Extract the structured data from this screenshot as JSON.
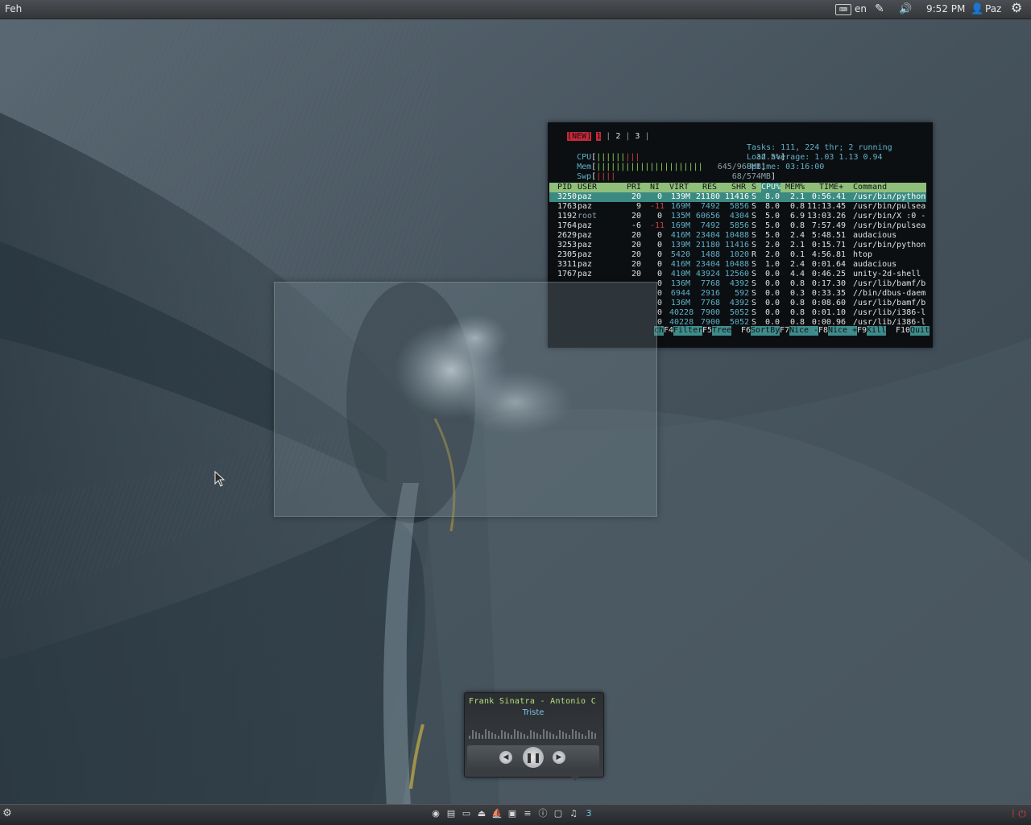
{
  "top_panel": {
    "app_name": "Feh",
    "keyboard_layout": "en",
    "clock": "9:52 PM",
    "user": "Paz"
  },
  "htop": {
    "tabs": [
      "[NEW]",
      "1",
      "2",
      "3"
    ],
    "meters": {
      "cpu_label": "CPU",
      "cpu_value": "32.5%",
      "mem_label": "Mem",
      "mem_value": "645/968MB",
      "swp_label": "Swp",
      "swp_value": "68/574MB"
    },
    "stats": {
      "tasks": "Tasks: 111, 224 thr; 2 running",
      "load": "Load average: 1.03 1.13 0.94",
      "uptime": "Uptime: 03:16:00"
    },
    "columns": [
      "PID",
      "USER",
      "PRI",
      "NI",
      "VIRT",
      "RES",
      "SHR",
      "S",
      "CPU%",
      "MEM%",
      "TIME+",
      "Command"
    ],
    "processes": [
      {
        "pid": "3250",
        "user": "paz",
        "pri": "20",
        "ni": "0",
        "virt": "139M",
        "res": "21180",
        "shr": "11416",
        "s": "S",
        "cpu": "8.0",
        "mem": "2.1",
        "time": "0:56.41",
        "cmd": "/usr/bin/python"
      },
      {
        "pid": "1763",
        "user": "paz",
        "pri": "9",
        "ni": "-11",
        "virt": "169M",
        "res": "7492",
        "shr": "5856",
        "s": "S",
        "cpu": "8.0",
        "mem": "0.8",
        "time": "11:13.45",
        "cmd": "/usr/bin/pulsea"
      },
      {
        "pid": "1192",
        "user": "root",
        "pri": "20",
        "ni": "0",
        "virt": "135M",
        "res": "60656",
        "shr": "4304",
        "s": "S",
        "cpu": "5.0",
        "mem": "6.9",
        "time": "13:03.26",
        "cmd": "/usr/bin/X :0 -"
      },
      {
        "pid": "1764",
        "user": "paz",
        "pri": "-6",
        "ni": "-11",
        "virt": "169M",
        "res": "7492",
        "shr": "5856",
        "s": "S",
        "cpu": "5.0",
        "mem": "0.8",
        "time": "7:57.49",
        "cmd": "/usr/bin/pulsea"
      },
      {
        "pid": "2629",
        "user": "paz",
        "pri": "20",
        "ni": "0",
        "virt": "416M",
        "res": "23404",
        "shr": "10488",
        "s": "S",
        "cpu": "5.0",
        "mem": "2.4",
        "time": "5:48.51",
        "cmd": "audacious"
      },
      {
        "pid": "3253",
        "user": "paz",
        "pri": "20",
        "ni": "0",
        "virt": "139M",
        "res": "21180",
        "shr": "11416",
        "s": "S",
        "cpu": "2.0",
        "mem": "2.1",
        "time": "0:15.71",
        "cmd": "/usr/bin/python"
      },
      {
        "pid": "2305",
        "user": "paz",
        "pri": "20",
        "ni": "0",
        "virt": "5420",
        "res": "1488",
        "shr": "1020",
        "s": "R",
        "cpu": "2.0",
        "mem": "0.1",
        "time": "4:56.81",
        "cmd": "htop"
      },
      {
        "pid": "3311",
        "user": "paz",
        "pri": "20",
        "ni": "0",
        "virt": "416M",
        "res": "23404",
        "shr": "10488",
        "s": "S",
        "cpu": "1.0",
        "mem": "2.4",
        "time": "0:01.64",
        "cmd": "audacious"
      },
      {
        "pid": "1767",
        "user": "paz",
        "pri": "20",
        "ni": "0",
        "virt": "410M",
        "res": "43924",
        "shr": "12560",
        "s": "S",
        "cpu": "0.0",
        "mem": "4.4",
        "time": "0:46.25",
        "cmd": "unity-2d-shell"
      },
      {
        "pid": "",
        "user": "",
        "pri": "",
        "ni": "0",
        "virt": "136M",
        "res": "7768",
        "shr": "4392",
        "s": "S",
        "cpu": "0.0",
        "mem": "0.8",
        "time": "0:17.30",
        "cmd": "/usr/lib/bamf/b"
      },
      {
        "pid": "",
        "user": "",
        "pri": "",
        "ni": "0",
        "virt": "6944",
        "res": "2916",
        "shr": "592",
        "s": "S",
        "cpu": "0.0",
        "mem": "0.3",
        "time": "0:33.35",
        "cmd": "//bin/dbus-daem"
      },
      {
        "pid": "",
        "user": "",
        "pri": "",
        "ni": "0",
        "virt": "136M",
        "res": "7768",
        "shr": "4392",
        "s": "S",
        "cpu": "0.0",
        "mem": "0.8",
        "time": "0:08.60",
        "cmd": "/usr/lib/bamf/b"
      },
      {
        "pid": "",
        "user": "",
        "pri": "",
        "ni": "0",
        "virt": "40228",
        "res": "7900",
        "shr": "5052",
        "s": "S",
        "cpu": "0.0",
        "mem": "0.8",
        "time": "0:01.10",
        "cmd": "/usr/lib/i386-l"
      },
      {
        "pid": "",
        "user": "",
        "pri": "",
        "ni": "0",
        "virt": "40228",
        "res": "7900",
        "shr": "5052",
        "s": "S",
        "cpu": "0.0",
        "mem": "0.8",
        "time": "0:00.96",
        "cmd": "/usr/lib/i386-l"
      }
    ],
    "function_keys": [
      {
        "key": "",
        "label": "ch"
      },
      {
        "key": "F4",
        "label": "Filter"
      },
      {
        "key": "F5",
        "label": "Tree  "
      },
      {
        "key": "F6",
        "label": "SortBy"
      },
      {
        "key": "F7",
        "label": "Nice -"
      },
      {
        "key": "F8",
        "label": "Nice +"
      },
      {
        "key": "F9",
        "label": "Kill  "
      },
      {
        "key": "F10",
        "label": "Quit"
      }
    ]
  },
  "music_player": {
    "track": "Frank Sinatra - Antonio C ...",
    "album": "Triste"
  },
  "bottom_panel": {
    "workspace_count": "3"
  },
  "colors": {
    "accent_red": "#c8283a",
    "header_green": "#8fbf7a",
    "selection_teal": "#3b8a82",
    "track_green": "#b5e07a",
    "track_blue": "#7ac4e8"
  }
}
